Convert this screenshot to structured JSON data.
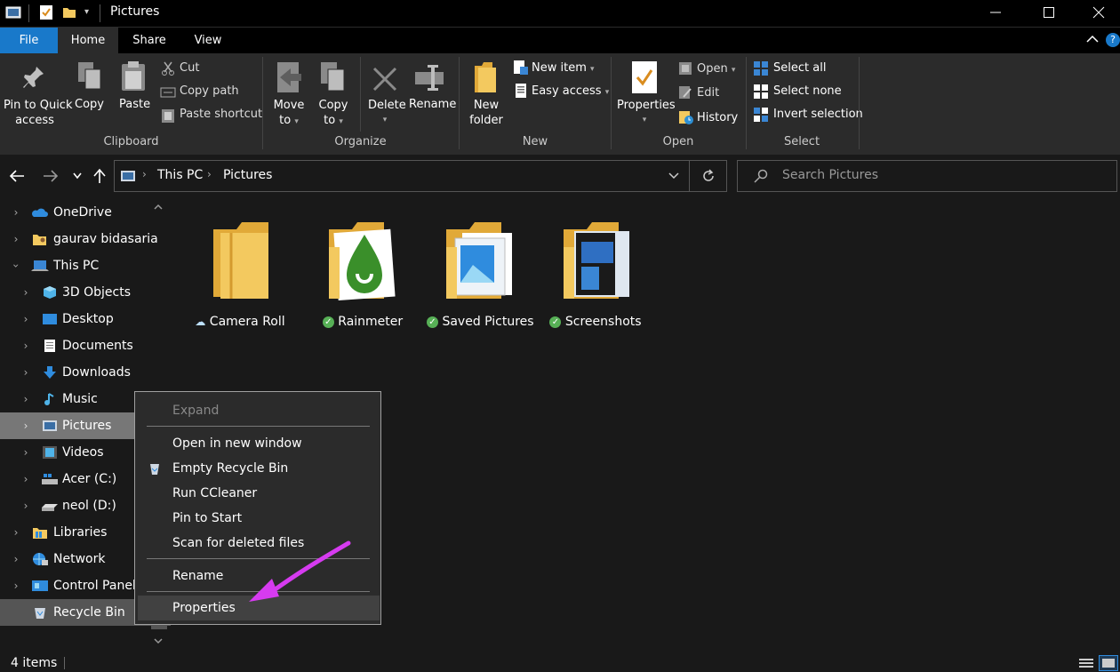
{
  "window": {
    "title": "Pictures",
    "minimize_icon": "minimize-icon",
    "maximize_icon": "maximize-icon",
    "close_icon": "close-icon"
  },
  "ribbon_tabs": [
    {
      "label": "File",
      "active_color": "#1979ca"
    },
    {
      "label": "Home"
    },
    {
      "label": "Share"
    },
    {
      "label": "View"
    }
  ],
  "ribbon": {
    "clipboard": {
      "group": "Clipboard",
      "pin_line1": "Pin to Quick",
      "pin_line2": "access",
      "copy": "Copy",
      "paste": "Paste",
      "cut": "Cut",
      "copy_path": "Copy path",
      "paste_shortcut": "Paste shortcut"
    },
    "organize": {
      "group": "Organize",
      "move_line1": "Move",
      "move_line2": "to",
      "copy_line1": "Copy",
      "copy_line2": "to",
      "delete": "Delete",
      "rename": "Rename"
    },
    "new": {
      "group": "New",
      "folder_line1": "New",
      "folder_line2": "folder",
      "new_item": "New item",
      "easy_access": "Easy access"
    },
    "open": {
      "group": "Open",
      "properties": "Properties",
      "open": "Open",
      "edit": "Edit",
      "history": "History"
    },
    "select": {
      "group": "Select",
      "select_all": "Select all",
      "select_none": "Select none",
      "invert": "Invert selection"
    }
  },
  "address": {
    "crumbs": [
      "This PC",
      "Pictures"
    ],
    "search_placeholder": "Search Pictures"
  },
  "nav_items": [
    {
      "label": "OneDrive"
    },
    {
      "label": "gaurav bidasaria"
    },
    {
      "label": "This PC"
    },
    {
      "label": "3D Objects"
    },
    {
      "label": "Desktop"
    },
    {
      "label": "Documents"
    },
    {
      "label": "Downloads"
    },
    {
      "label": "Music"
    },
    {
      "label": "Pictures"
    },
    {
      "label": "Videos"
    },
    {
      "label": "Acer (C:)"
    },
    {
      "label": "neol (D:)"
    },
    {
      "label": "Libraries"
    },
    {
      "label": "Network"
    },
    {
      "label": "Control Panel"
    },
    {
      "label": "Recycle Bin"
    }
  ],
  "folders": [
    {
      "label": "Camera Roll",
      "status": "cloud"
    },
    {
      "label": "Rainmeter",
      "status": "synced"
    },
    {
      "label": "Saved Pictures",
      "status": "synced"
    },
    {
      "label": "Screenshots",
      "status": "synced"
    }
  ],
  "status": {
    "count": "4 items"
  },
  "context_menu": {
    "expand": "Expand",
    "open_new_window": "Open in new window",
    "empty_recycle": "Empty Recycle Bin",
    "run_ccleaner": "Run CCleaner",
    "pin_start": "Pin to Start",
    "scan_deleted": "Scan for deleted files",
    "rename": "Rename",
    "properties": "Properties"
  },
  "colors": {
    "accent": "#1979ca",
    "annotation_arrow": "#d63bf0",
    "folder": "#f3c95f"
  }
}
